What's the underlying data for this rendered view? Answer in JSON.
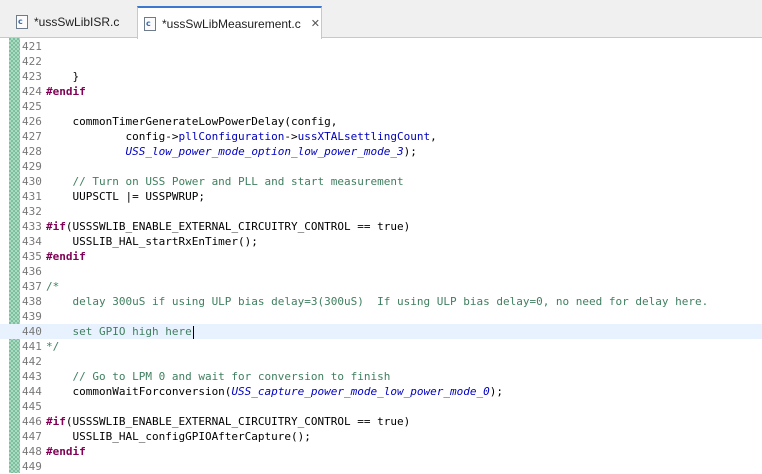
{
  "tabs": [
    {
      "label": "*ussSwLibISR.c",
      "icon": "c-file-icon",
      "active": false
    },
    {
      "label": "*ussSwLibMeasurement.c",
      "icon": "c-file-icon",
      "active": true,
      "close": "✕"
    }
  ],
  "file_icon_letter": "c",
  "lines": [
    {
      "num": "421",
      "segments": []
    },
    {
      "num": "422",
      "segments": []
    },
    {
      "num": "423",
      "segments": [
        {
          "t": "    }",
          "c": "plain"
        }
      ]
    },
    {
      "num": "424",
      "segments": [
        {
          "t": "#endif",
          "c": "kw"
        }
      ]
    },
    {
      "num": "425",
      "segments": []
    },
    {
      "num": "426",
      "segments": [
        {
          "t": "    commonTimerGenerateLowPowerDelay(config,",
          "c": "plain"
        }
      ]
    },
    {
      "num": "427",
      "segments": [
        {
          "t": "            config->",
          "c": "plain"
        },
        {
          "t": "pllConfiguration",
          "c": "fld"
        },
        {
          "t": "->",
          "c": "plain"
        },
        {
          "t": "ussXTALsettlingCount",
          "c": "fld"
        },
        {
          "t": ",",
          "c": "plain"
        }
      ]
    },
    {
      "num": "428",
      "segments": [
        {
          "t": "            ",
          "c": "plain"
        },
        {
          "t": "USS_low_power_mode_option_low_power_mode_3",
          "c": "en"
        },
        {
          "t": ");",
          "c": "plain"
        }
      ]
    },
    {
      "num": "429",
      "segments": []
    },
    {
      "num": "430",
      "segments": [
        {
          "t": "    // Turn on USS Power and PLL and start measurement",
          "c": "cm"
        }
      ]
    },
    {
      "num": "431",
      "segments": [
        {
          "t": "    UUPSCTL |= USSPWRUP;",
          "c": "plain"
        }
      ]
    },
    {
      "num": "432",
      "segments": []
    },
    {
      "num": "433",
      "segments": [
        {
          "t": "#if",
          "c": "kw"
        },
        {
          "t": "(USSSWLIB_ENABLE_EXTERNAL_CIRCUITRY_CONTROL == true)",
          "c": "plain"
        }
      ]
    },
    {
      "num": "434",
      "segments": [
        {
          "t": "    USSLIB_HAL_startRxEnTimer();",
          "c": "plain"
        }
      ]
    },
    {
      "num": "435",
      "segments": [
        {
          "t": "#endif",
          "c": "kw"
        }
      ]
    },
    {
      "num": "436",
      "segments": []
    },
    {
      "num": "437",
      "segments": [
        {
          "t": "/*",
          "c": "cm"
        }
      ]
    },
    {
      "num": "438",
      "segments": [
        {
          "t": "    delay 300uS if using ULP bias delay=3(300uS)  If using ULP bias delay=0, no need for delay here.",
          "c": "cm"
        }
      ]
    },
    {
      "num": "439",
      "segments": []
    },
    {
      "num": "440",
      "segments": [
        {
          "t": "    set GPIO high here",
          "c": "cm"
        }
      ],
      "current": true
    },
    {
      "num": "441",
      "segments": [
        {
          "t": "*/",
          "c": "cm"
        }
      ]
    },
    {
      "num": "442",
      "segments": []
    },
    {
      "num": "443",
      "segments": [
        {
          "t": "    // Go to LPM 0 and wait for conversion to finish",
          "c": "cm"
        }
      ]
    },
    {
      "num": "444",
      "segments": [
        {
          "t": "    commonWaitForconversion(",
          "c": "plain"
        },
        {
          "t": "USS_capture_power_mode_low_power_mode_0",
          "c": "en"
        },
        {
          "t": ");",
          "c": "plain"
        }
      ]
    },
    {
      "num": "445",
      "segments": []
    },
    {
      "num": "446",
      "segments": [
        {
          "t": "#if",
          "c": "kw"
        },
        {
          "t": "(USSSWLIB_ENABLE_EXTERNAL_CIRCUITRY_CONTROL == true)",
          "c": "plain"
        }
      ]
    },
    {
      "num": "447",
      "segments": [
        {
          "t": "    USSLIB_HAL_configGPIOAfterCapture();",
          "c": "plain"
        }
      ]
    },
    {
      "num": "448",
      "segments": [
        {
          "t": "#endif",
          "c": "kw"
        }
      ]
    },
    {
      "num": "449",
      "segments": []
    }
  ]
}
